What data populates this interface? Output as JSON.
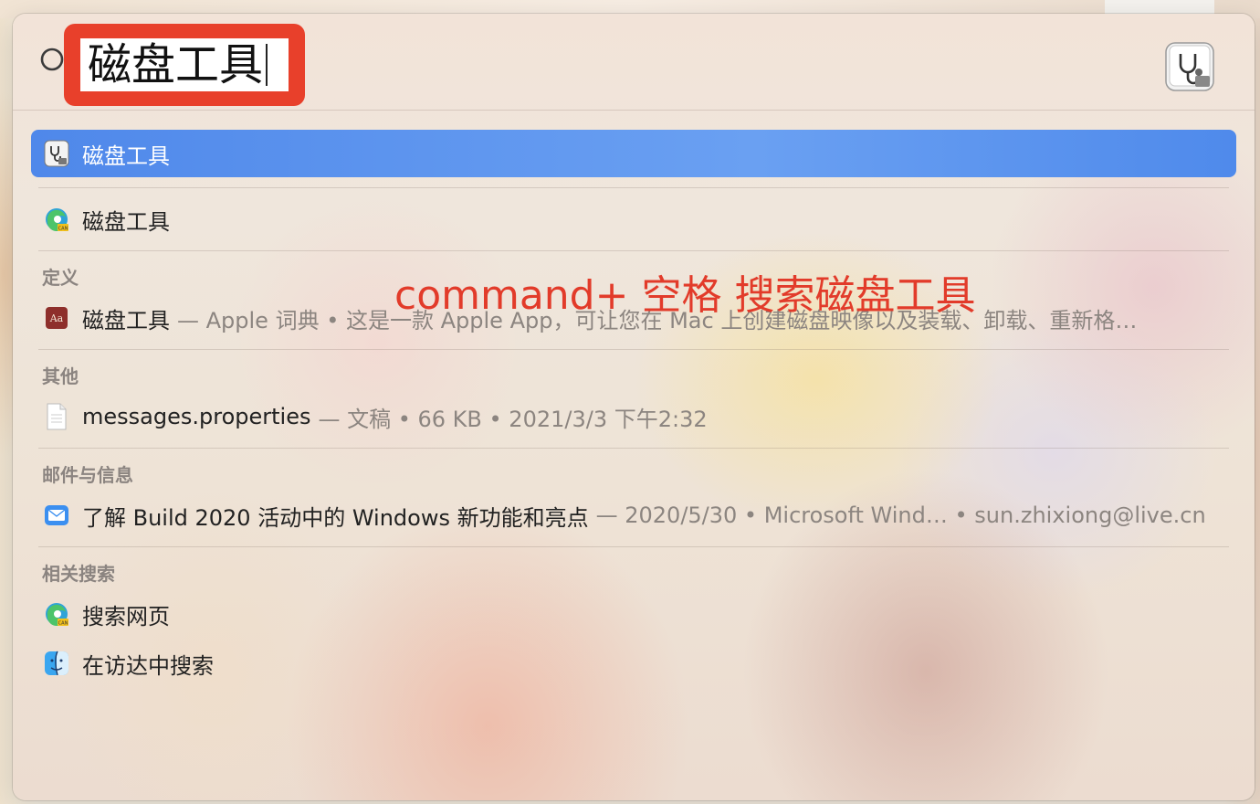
{
  "search": {
    "query": "磁盘工具"
  },
  "annotation": {
    "text": "command+ 空格 搜索磁盘工具",
    "color": "#e23b2a"
  },
  "top_hit": {
    "icon": "disk-utility-icon",
    "label": "磁盘工具"
  },
  "web_hit": {
    "icon": "edge-browser-icon",
    "label": "磁盘工具"
  },
  "sections": {
    "definition": {
      "header": "定义",
      "item": {
        "icon": "dictionary-icon",
        "label": "磁盘工具",
        "meta": "— Apple 词典 • 这是一款 Apple App，可让您在 Mac 上创建磁盘映像以及装载、卸载、重新格…"
      }
    },
    "other": {
      "header": "其他",
      "item": {
        "icon": "document-icon",
        "label": "messages.properties",
        "meta": "— 文稿 • 66 KB • 2021/3/3 下午2:32"
      }
    },
    "mail": {
      "header": "邮件与信息",
      "item": {
        "icon": "mail-icon",
        "label": "了解 Build 2020 活动中的 Windows 新功能和亮点",
        "meta": "— 2020/5/30 • Microsoft Wind… • sun.zhixiong@live.cn"
      }
    },
    "related": {
      "header": "相关搜索",
      "items": [
        {
          "icon": "edge-browser-icon",
          "label": "搜索网页"
        },
        {
          "icon": "finder-icon",
          "label": "在访达中搜索"
        }
      ]
    }
  },
  "colors": {
    "selection": "#5b93ee",
    "annotation_box": "#e8402b"
  }
}
